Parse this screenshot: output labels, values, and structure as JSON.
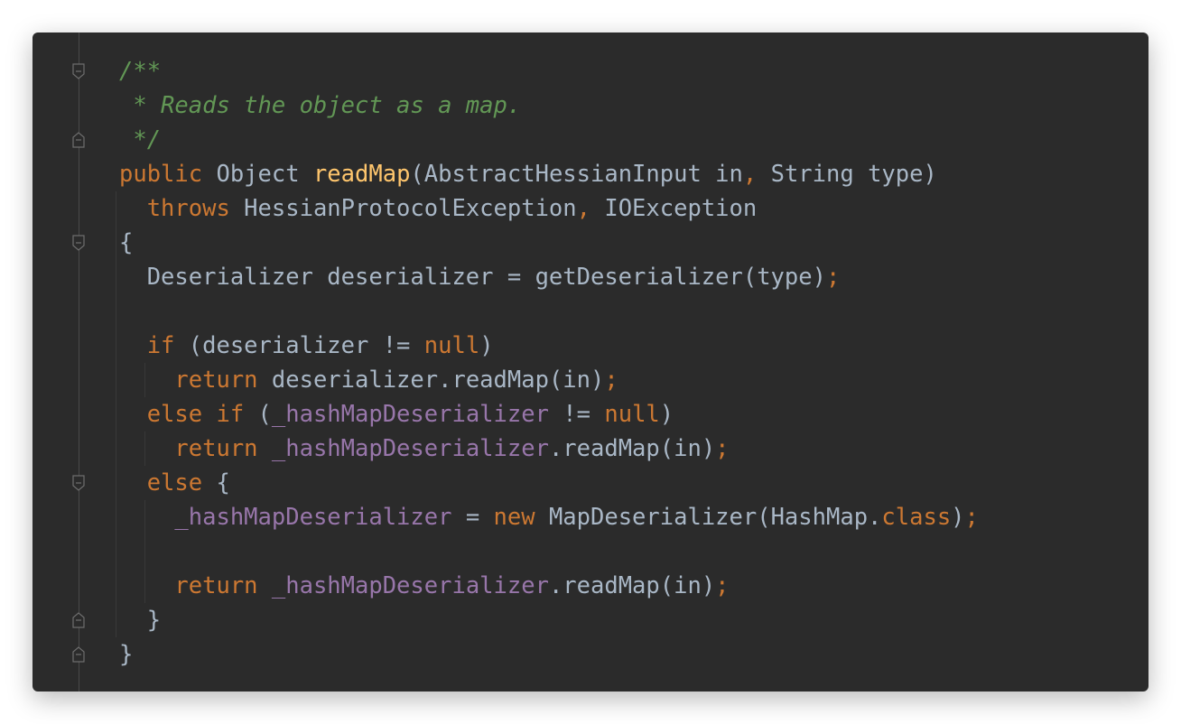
{
  "editor": {
    "lines": [
      [
        {
          "t": "/**",
          "c": "comment"
        }
      ],
      [
        {
          "t": " * Reads the object as a map.",
          "c": "comment"
        }
      ],
      [
        {
          "t": " */",
          "c": "comment"
        }
      ],
      [
        {
          "t": "public",
          "c": "kw"
        },
        {
          "t": " Object ",
          "c": "id"
        },
        {
          "t": "readMap",
          "c": "fn"
        },
        {
          "t": "(AbstractHessianInput in",
          "c": "id"
        },
        {
          "t": ",",
          "c": "kw"
        },
        {
          "t": " String type)",
          "c": "id"
        }
      ],
      [
        {
          "t": "  throws",
          "c": "kw"
        },
        {
          "t": " HessianProtocolException",
          "c": "id"
        },
        {
          "t": ",",
          "c": "kw"
        },
        {
          "t": " IOException",
          "c": "id"
        }
      ],
      [
        {
          "t": "{",
          "c": "id"
        }
      ],
      [
        {
          "t": "  Deserializer deserializer = getDeserializer(type)",
          "c": "id"
        },
        {
          "t": ";",
          "c": "kw"
        }
      ],
      [
        {
          "t": "",
          "c": "id"
        }
      ],
      [
        {
          "t": "  if",
          "c": "kw"
        },
        {
          "t": " (deserializer != ",
          "c": "id"
        },
        {
          "t": "null",
          "c": "kw"
        },
        {
          "t": ")",
          "c": "id"
        }
      ],
      [
        {
          "t": "    return",
          "c": "kw"
        },
        {
          "t": " deserializer.readMap(in)",
          "c": "id"
        },
        {
          "t": ";",
          "c": "kw"
        }
      ],
      [
        {
          "t": "  else if",
          "c": "kw"
        },
        {
          "t": " (",
          "c": "id"
        },
        {
          "t": "_hashMapDeserializer",
          "c": "field"
        },
        {
          "t": " != ",
          "c": "id"
        },
        {
          "t": "null",
          "c": "kw"
        },
        {
          "t": ")",
          "c": "id"
        }
      ],
      [
        {
          "t": "    return",
          "c": "kw"
        },
        {
          "t": " ",
          "c": "id"
        },
        {
          "t": "_hashMapDeserializer",
          "c": "field"
        },
        {
          "t": ".readMap(in)",
          "c": "id"
        },
        {
          "t": ";",
          "c": "kw"
        }
      ],
      [
        {
          "t": "  else",
          "c": "kw"
        },
        {
          "t": " {",
          "c": "id"
        }
      ],
      [
        {
          "t": "    ",
          "c": "id"
        },
        {
          "t": "_hashMapDeserializer",
          "c": "field"
        },
        {
          "t": " = ",
          "c": "id"
        },
        {
          "t": "new",
          "c": "kw"
        },
        {
          "t": " MapDeserializer(HashMap.",
          "c": "id"
        },
        {
          "t": "class",
          "c": "kw"
        },
        {
          "t": ")",
          "c": "id"
        },
        {
          "t": ";",
          "c": "kw"
        }
      ],
      [
        {
          "t": "",
          "c": "id"
        }
      ],
      [
        {
          "t": "    return",
          "c": "kw"
        },
        {
          "t": " ",
          "c": "id"
        },
        {
          "t": "_hashMapDeserializer",
          "c": "field"
        },
        {
          "t": ".readMap(in)",
          "c": "id"
        },
        {
          "t": ";",
          "c": "kw"
        }
      ],
      [
        {
          "t": "  }",
          "c": "id"
        }
      ],
      [
        {
          "t": "}",
          "c": "id"
        }
      ]
    ],
    "fold_markers": [
      {
        "line": 0,
        "kind": "open"
      },
      {
        "line": 2,
        "kind": "close"
      },
      {
        "line": 5,
        "kind": "open"
      },
      {
        "line": 12,
        "kind": "open"
      },
      {
        "line": 16,
        "kind": "close"
      },
      {
        "line": 17,
        "kind": "close"
      }
    ]
  },
  "colors": {
    "background": "#2b2b2b",
    "comment": "#629755",
    "keyword": "#cc7832",
    "function": "#ffc66d",
    "field": "#9876aa",
    "identifier": "#a9b7c6"
  }
}
